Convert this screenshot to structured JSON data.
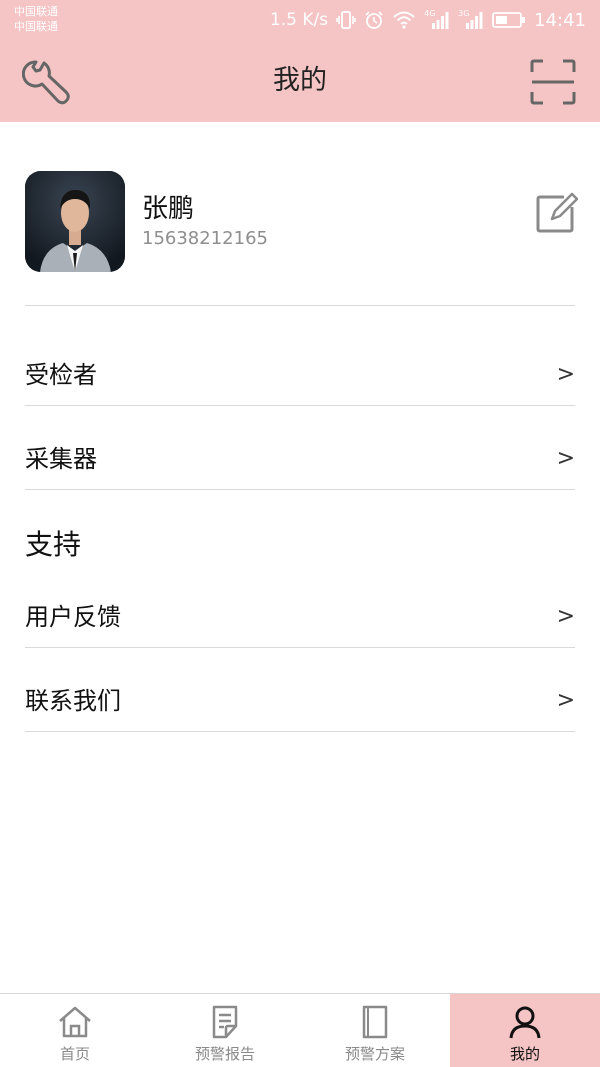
{
  "status_bar": {
    "carrier_1": "中国联通",
    "carrier_2": "中国联通",
    "net_speed": "1.5 K/s",
    "network_badge_1": "4G",
    "network_badge_2": "3G",
    "time": "14:41",
    "icons": [
      "vibrate-icon",
      "alarm-icon",
      "wifi-icon",
      "signal-icon",
      "signal-icon",
      "battery-icon"
    ]
  },
  "header": {
    "title": "我的",
    "left_icon": "wrench-icon",
    "right_icon": "scan-icon"
  },
  "profile": {
    "name": "张鹏",
    "phone": "15638212165",
    "edit_icon": "edit-icon"
  },
  "menu": {
    "items": [
      {
        "label": "受检者",
        "arrow": ">"
      },
      {
        "label": "采集器",
        "arrow": ">"
      }
    ]
  },
  "support": {
    "title": "支持",
    "items": [
      {
        "label": "用户反馈",
        "arrow": ">"
      },
      {
        "label": "联系我们",
        "arrow": ">"
      }
    ]
  },
  "bottom_nav": {
    "items": [
      {
        "label": "首页",
        "icon": "home-icon",
        "active": false
      },
      {
        "label": "预警报告",
        "icon": "report-icon",
        "active": false
      },
      {
        "label": "预警方案",
        "icon": "book-icon",
        "active": false
      },
      {
        "label": "我的",
        "icon": "user-icon",
        "active": true
      }
    ]
  },
  "colors": {
    "accent": "#f5c4c5",
    "divider": "#d9d9d9",
    "secondary_text": "#8e8e8e"
  }
}
